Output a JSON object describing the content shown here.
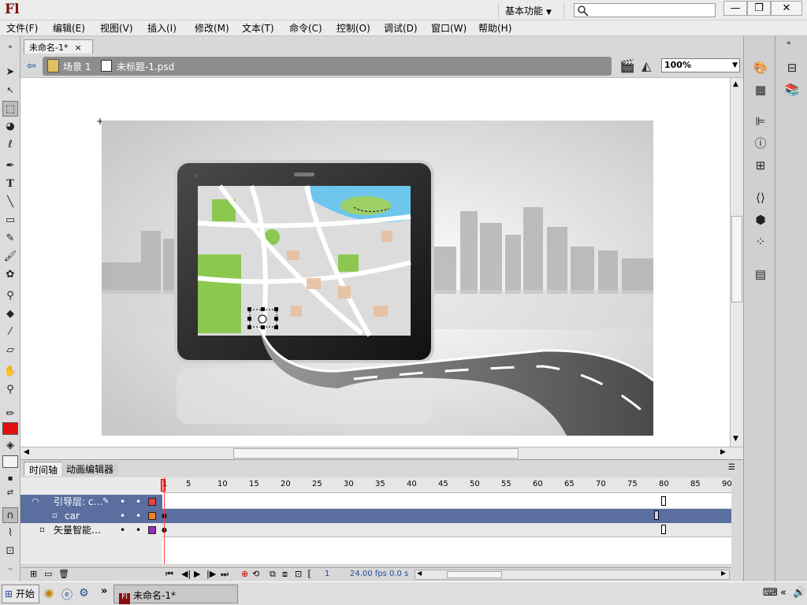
{
  "app": {
    "logo": "Fl",
    "workspace": "基本功能"
  },
  "window_controls": {
    "minimize": "—",
    "maximize": "❐",
    "close": "✕"
  },
  "menu": [
    "文件(F)",
    "编辑(E)",
    "视图(V)",
    "插入(I)",
    "修改(M)",
    "文本(T)",
    "命令(C)",
    "控制(O)",
    "调试(D)",
    "窗口(W)",
    "帮助(H)"
  ],
  "document": {
    "tab": "未命名-1*",
    "close": "×"
  },
  "edit_bar": {
    "scene": "场景 1",
    "symbol": "未标题-1.psd",
    "zoom": "100%"
  },
  "timeline": {
    "tabs": [
      "时间轴",
      "动画编辑器"
    ],
    "ruler": [
      "1",
      "5",
      "10",
      "15",
      "20",
      "25",
      "30",
      "35",
      "40",
      "45",
      "50",
      "55",
      "60",
      "65",
      "70",
      "75",
      "80",
      "85",
      "90"
    ],
    "layers": [
      {
        "name": "引导层: c…",
        "color": "#e84040"
      },
      {
        "name": "car",
        "color": "#f08020"
      },
      {
        "name": "矢量智能…",
        "color": "#9030c0"
      }
    ],
    "status": {
      "frame": "1",
      "fps": "24.00 fps",
      "time": "0.0 s"
    }
  },
  "taskbar": {
    "start": "开始",
    "item": "未命名-1*",
    "arrow": "»"
  },
  "colors": {
    "stroke": "#e01010",
    "accent": "#5a6ea0"
  }
}
